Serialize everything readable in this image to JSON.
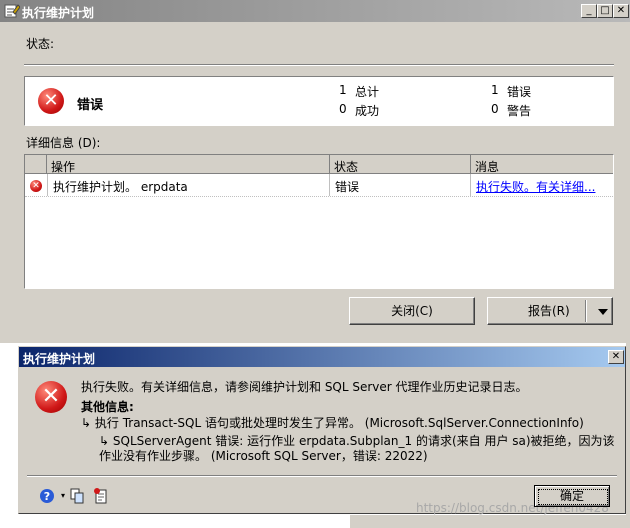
{
  "main_window": {
    "title": "执行维护计划",
    "status_label": "状态:",
    "status_word": "错误",
    "stats": {
      "total_count": "1",
      "total_label": "总计",
      "success_count": "0",
      "success_label": "成功",
      "error_count": "1",
      "error_label": "错误",
      "warning_count": "0",
      "warning_label": "警告"
    },
    "details_label": "详细信息 (D):",
    "columns": [
      "操作",
      "状态",
      "消息"
    ],
    "rows": [
      {
        "action": "执行维护计划。 erpdata",
        "status": "错误",
        "message": "执行失败。有关详细..."
      }
    ],
    "close_button": "关闭(C)",
    "report_button": "报告(R)"
  },
  "dialog": {
    "title": "执行维护计划",
    "message": "执行失败。有关详细信息，请参阅维护计划和 SQL Server 代理作业历史记录日志。",
    "additional_label": "其他信息:",
    "detail1": "执行 Transact-SQL 语句或批处理时发生了异常。 (Microsoft.SqlServer.ConnectionInfo)",
    "detail2": "SQLServerAgent 错误: 运行作业 erpdata.Subplan_1 的请求(来自 用户 sa)被拒绝，因为该作业没有作业步骤。 (Microsoft SQL Server，错误: 22022)",
    "ok_button": "确定",
    "watermark": "https://blog.csdn.net/jeffen0428"
  },
  "colors": {
    "titlebar_inactive": "#848484",
    "titlebar_active": "#0a246a",
    "link": "#0000ff",
    "error_red": "#d01818"
  }
}
